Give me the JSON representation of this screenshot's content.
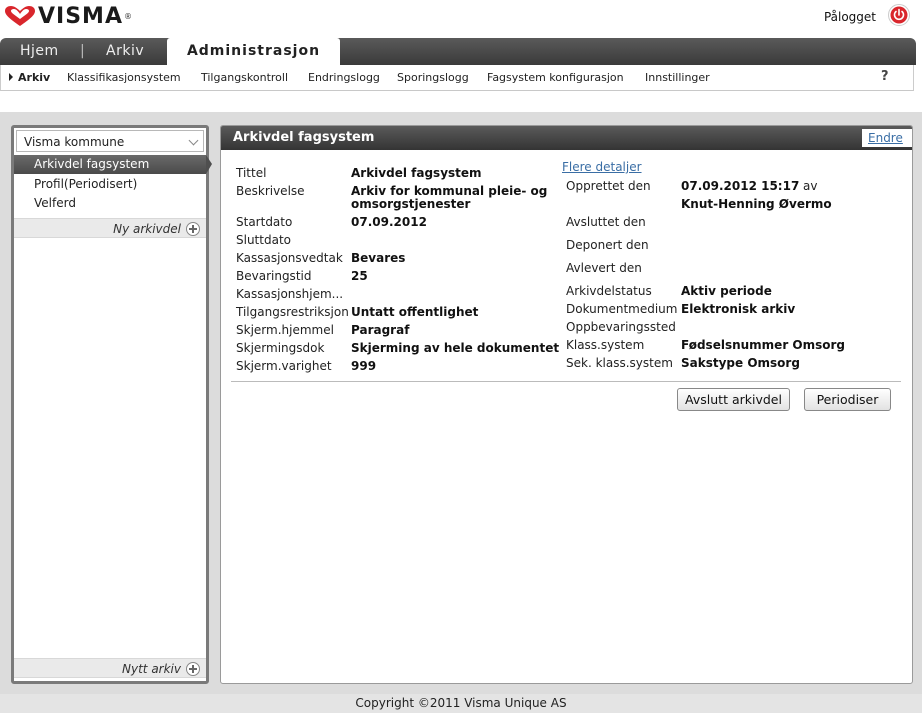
{
  "header": {
    "logo_text": "VISMA",
    "logo_reg": "®",
    "logged_in_label": "Pålogget",
    "brand_color": "#d9262c"
  },
  "main_tabs": {
    "home": "Hjem",
    "separator": "|",
    "archive": "Arkiv",
    "admin": "Administrasjon"
  },
  "sub_nav": {
    "items": [
      "Arkiv",
      "Klassifikasjonsystem",
      "Tilgangskontroll",
      "Endringslogg",
      "Sporingslogg",
      "Fagsystem konfigurasjon",
      "Innstillinger"
    ],
    "help": "?"
  },
  "sidebar": {
    "org_select": "Visma kommune",
    "items": [
      "Arkivdel fagsystem",
      "Profil(Periodisert)",
      "Velferd"
    ],
    "new_part_label": "Ny arkivdel",
    "new_archive_label": "Nytt arkiv"
  },
  "detail": {
    "title": "Arkivdel fagsystem",
    "edit_label": "Endre",
    "more_details_label": "Flere detaljer",
    "left": {
      "tittel_label": "Tittel",
      "tittel_value": "Arkivdel fagsystem",
      "beskrivelse_label": "Beskrivelse",
      "beskrivelse_value_1": "Arkiv for kommunal pleie- og",
      "beskrivelse_value_2": "omsorgstjenester",
      "startdato_label": "Startdato",
      "startdato_value": "07.09.2012",
      "sluttdato_label": "Sluttdato",
      "kassasjonsvedtak_label": "Kassasjonsvedtak",
      "kassasjonsvedtak_value": "Bevares",
      "bevaringstid_label": "Bevaringstid",
      "bevaringstid_value": "25",
      "kassasjonshjemmel_label": "Kassasjonshjem...",
      "tilgangsrestriksjon_label": "Tilgangsrestriksjon",
      "tilgangsrestriksjon_value": "Untatt offentlighet",
      "skjerm_hjemmel_label": "Skjerm.hjemmel",
      "skjerm_hjemmel_value": "Paragraf",
      "skjermingsdok_label": "Skjermingsdok",
      "skjermingsdok_value": "Skjerming av hele dokumentet",
      "skjerm_varighet_label": "Skjerm.varighet",
      "skjerm_varighet_value": "999"
    },
    "right": {
      "opprettet_label": "Opprettet den",
      "opprettet_value": "07.09.2012 15:17",
      "opprettet_av": "av",
      "opprettet_by": "Knut-Henning Øvermo",
      "avsluttet_label": "Avsluttet den",
      "deponert_label": "Deponert den",
      "avlevert_label": "Avlevert den",
      "status_label": "Arkivdelstatus",
      "status_value": "Aktiv periode",
      "medium_label": "Dokumentmedium",
      "medium_value": "Elektronisk arkiv",
      "oppbevaring_label": "Oppbevaringssted",
      "klass_label": "Klass.system",
      "klass_value": "Fødselsnummer Omsorg",
      "sek_klass_label": "Sek. klass.system",
      "sek_klass_value": "Sakstype Omsorg"
    },
    "buttons": {
      "close_part": "Avslutt arkivdel",
      "periodize": "Periodiser"
    }
  },
  "footer": {
    "copyright": "Copyright ©2011 Visma Unique AS"
  }
}
